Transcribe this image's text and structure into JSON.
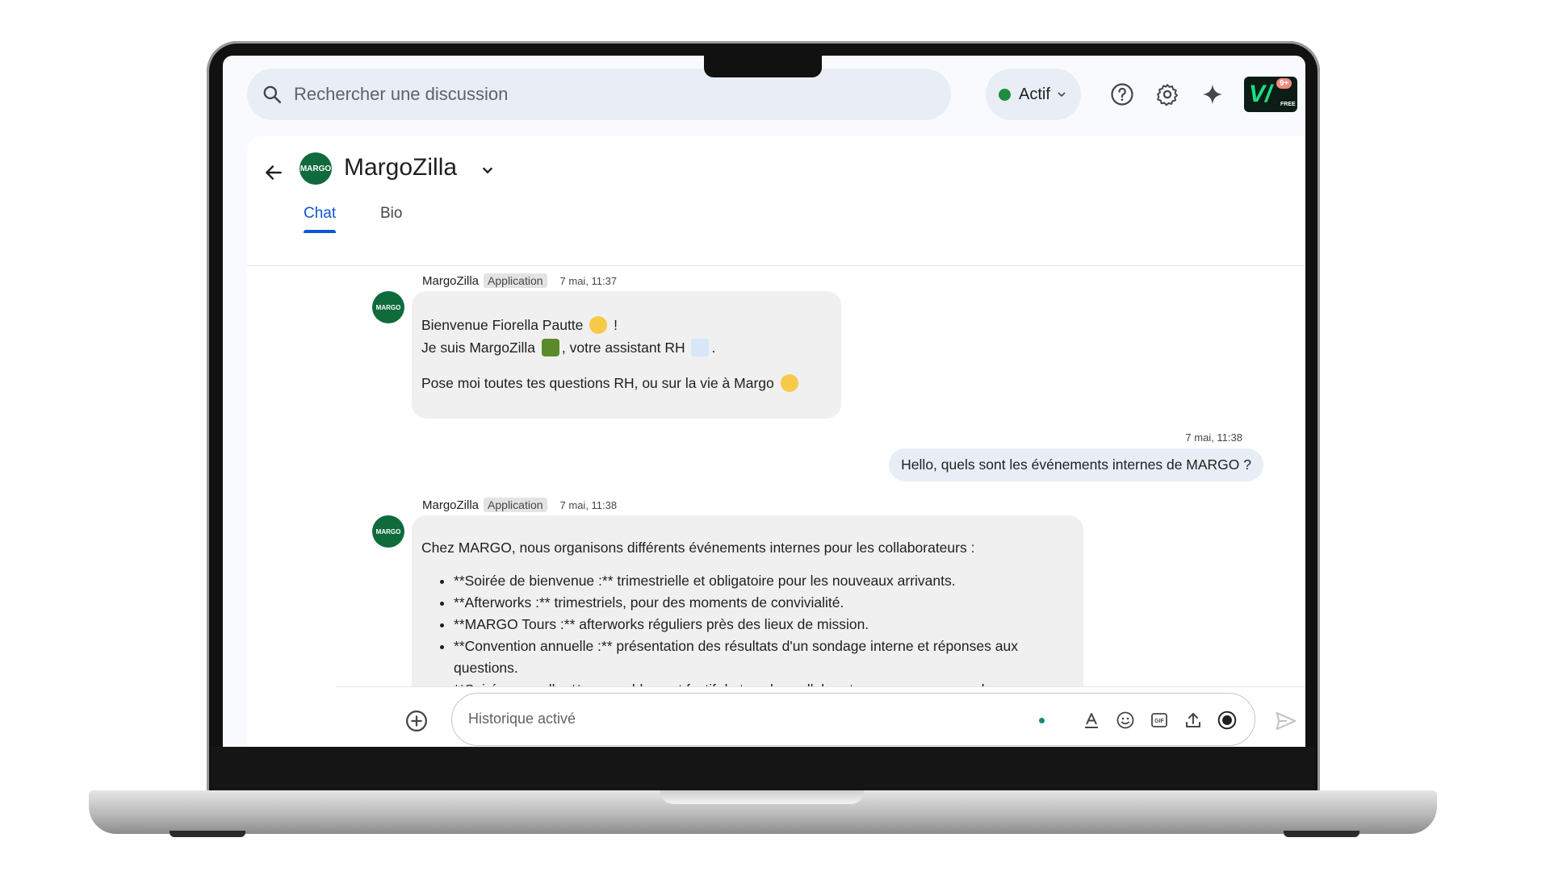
{
  "search": {
    "placeholder": "Rechercher une discussion"
  },
  "status": {
    "label": "Actif",
    "color": "#1e8e3e"
  },
  "top_icons": [
    "help-icon",
    "settings-icon",
    "gemini-sparkle-icon"
  ],
  "app_logo": {
    "text": "V/",
    "badge": "9+",
    "sub": "FREE"
  },
  "header": {
    "title": "MargoZilla",
    "avatar_text": "MARGO"
  },
  "tabs": [
    {
      "label": "Chat",
      "active": true
    },
    {
      "label": "Bio",
      "active": false
    }
  ],
  "messages": {
    "m1": {
      "sender": "MargoZilla",
      "tag": "Application",
      "time": "7 mai, 11:37",
      "line1": "Bienvenue Fiorella Pautte",
      "line1_end": "!",
      "line2_start": "Je suis MargoZilla",
      "line2_mid": ", votre assistant RH",
      "line2_end": ".",
      "line3": "Pose moi toutes tes questions RH, ou sur la vie à Margo"
    },
    "m2": {
      "time": "7 mai, 11:38",
      "text": "Hello, quels sont les événements internes de MARGO ?"
    },
    "m3": {
      "sender": "MargoZilla",
      "tag": "Application",
      "time": "7 mai, 11:38",
      "intro": "Chez MARGO, nous organisons différents événements internes pour les collaborateurs :",
      "items": [
        "**Soirée de bienvenue :** trimestrielle et obligatoire pour les nouveaux arrivants.",
        "**Afterworks :** trimestriels, pour des moments de convivialité.",
        "**MARGO Tours :** afterworks réguliers près des lieux de mission.",
        "**Convention annuelle :** présentation des résultats d'un sondage interne et réponses aux questions.",
        "**Soirée annuelle :** rassemblement festif de tous les collaborateurs avec annonce des"
      ]
    }
  },
  "composer": {
    "placeholder": "Historique activé"
  }
}
